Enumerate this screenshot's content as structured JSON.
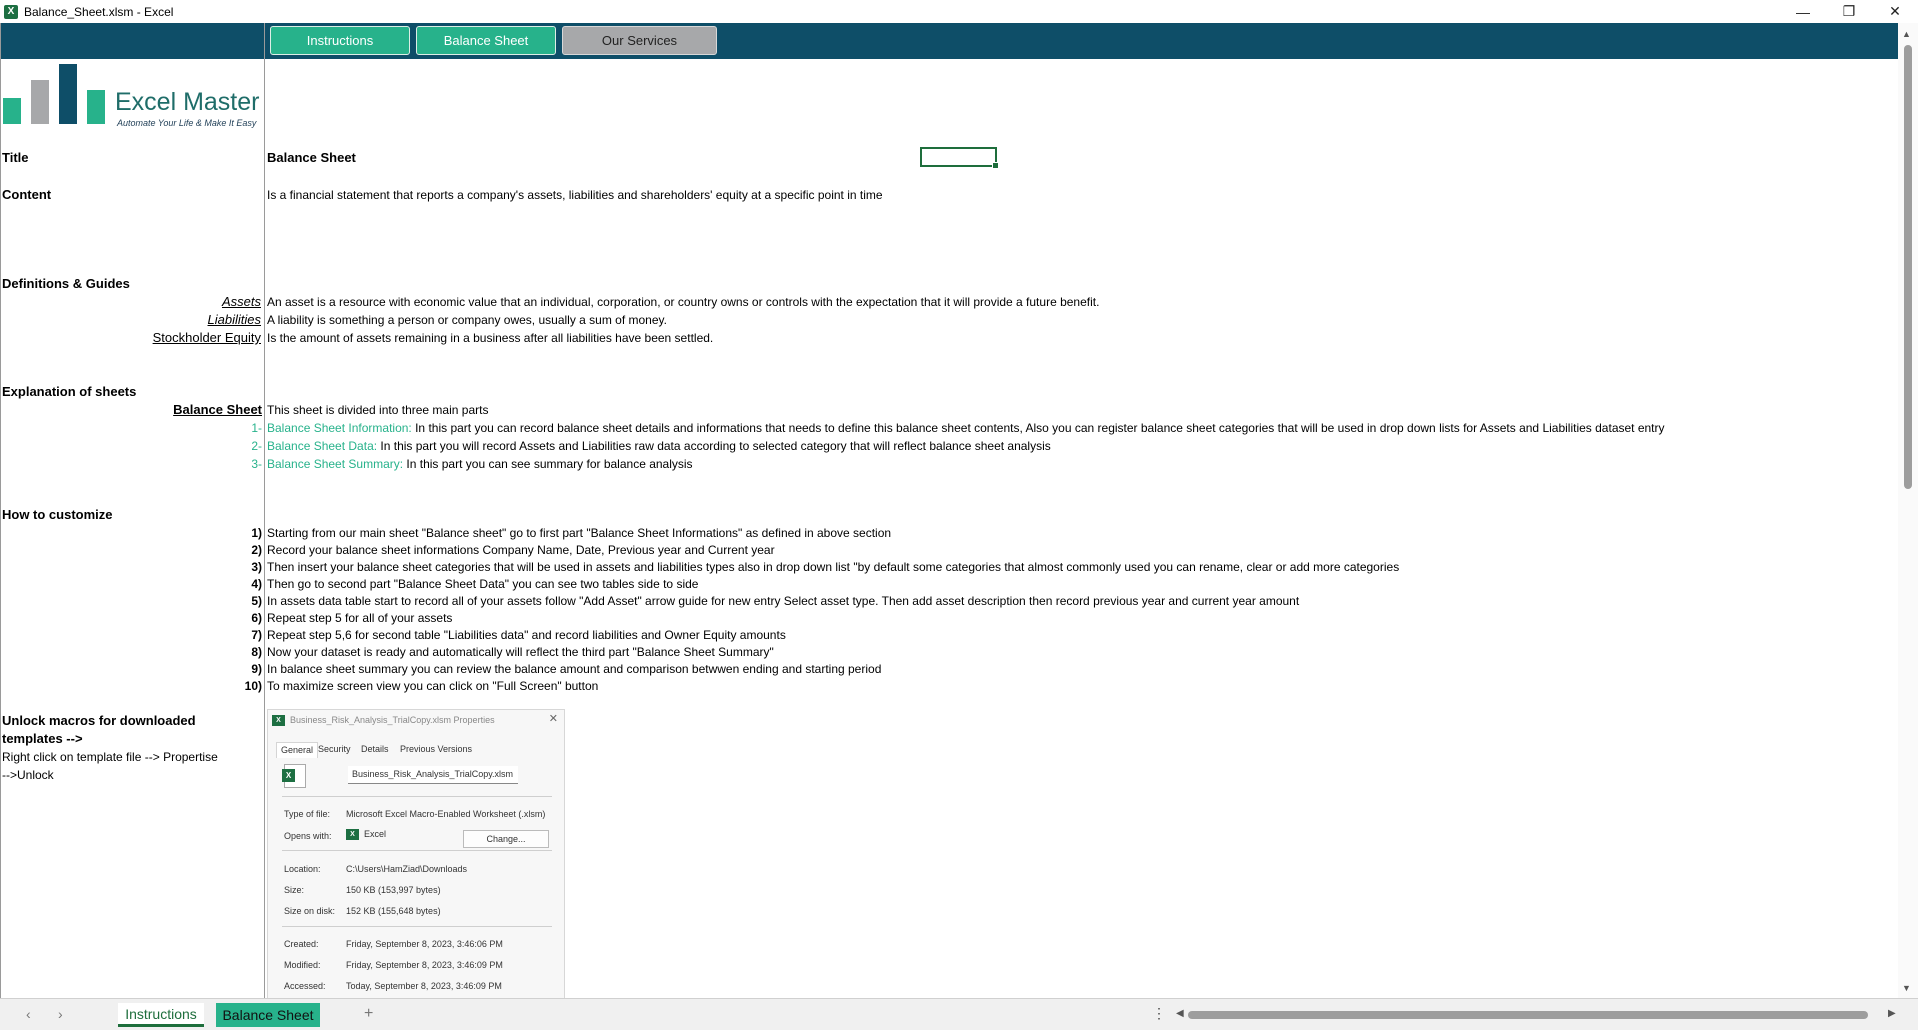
{
  "window": {
    "app_icon": "X",
    "title": "Balance_Sheet.xlsm - Excel",
    "minimize_icon": "minimize-icon",
    "restore_icon": "restore-icon",
    "close_icon": "close-icon"
  },
  "nav": {
    "instructions": "Instructions",
    "balance_sheet": "Balance Sheet",
    "our_services": "Our Services"
  },
  "logo": {
    "name": "Excel Master",
    "tagline": "Automate Your Life & Make It Easy"
  },
  "title": {
    "label": "Title",
    "value": "Balance Sheet"
  },
  "content": {
    "label": "Content",
    "value": "Is a financial statement that reports a company's assets, liabilities and shareholders' equity at a specific point in time"
  },
  "definitions": {
    "heading": "Definitions & Guides",
    "items": [
      {
        "term": "Assets",
        "text": "An asset is a resource with economic value that an individual, corporation, or country owns or controls with the expectation that it will provide a future benefit."
      },
      {
        "term": "Liabilities",
        "text": "A liability is something a person or company owes, usually a sum of money."
      },
      {
        "term": "Stockholder Equity",
        "text": "Is the amount of assets remaining in a business after all liabilities have been settled."
      }
    ]
  },
  "explanation": {
    "heading": "Explanation of sheets",
    "sheet_name": "Balance Sheet",
    "sheet_desc": "This sheet is divided into three main parts",
    "parts": [
      {
        "num": "1-",
        "name": "Balance Sheet Information:",
        "text": " In this part you can record balance sheet details and informations that needs to define this balance sheet contents, Also you can register balance sheet categories that will be used in drop down lists for Assets and Liabilities dataset entry"
      },
      {
        "num": "2-",
        "name": "Balance Sheet Data:",
        "text": " In this part you will record Assets and Liabilities raw data according to selected category that will reflect balance sheet analysis"
      },
      {
        "num": "3-",
        "name": "Balance Sheet Summary:",
        "text": " In this part you can see summary for balance analysis"
      }
    ]
  },
  "customize": {
    "heading": "How to customize",
    "steps": [
      {
        "num": "1)",
        "text": "Starting from our main sheet \"Balance sheet\" go to first part \"Balance Sheet Informations\" as defined in above section"
      },
      {
        "num": "2)",
        "text": "Record your balance sheet informations Company Name, Date, Previous year and Current year"
      },
      {
        "num": "3)",
        "text": "Then insert your balance sheet categories that will be used in assets and liabilities types also in drop down list \"by default some categories that almost commonly used you can rename, clear or add more categories"
      },
      {
        "num": "4)",
        "text": "Then go to second part \"Balance Sheet Data\" you can see two tables side to side"
      },
      {
        "num": "5)",
        "text": "In assets data table start to record all of your assets  follow \"Add Asset\" arrow guide for new entry Select asset type. Then add asset description then record previous year and current year amount"
      },
      {
        "num": "6)",
        "text": "Repeat step 5 for all of your assets"
      },
      {
        "num": "7)",
        "text": "Repeat step 5,6 for second table \"Liabilities data\" and record liabilities and Owner Equity amounts"
      },
      {
        "num": "8)",
        "text": "Now your dataset is ready and automatically will reflect the third part \"Balance Sheet Summary\""
      },
      {
        "num": "9)",
        "text": "In balance sheet summary you can review the balance amount and comparison betwwen ending and starting period"
      },
      {
        "num": "10)",
        "text": "To maximize screen view you can click on \"Full Screen\" button"
      }
    ]
  },
  "unlock": {
    "line1": "Unlock macros for downloaded",
    "line2": "templates -->",
    "line3": "Right click on template file --> Propertise",
    "line4": "-->Unlock"
  },
  "dialog": {
    "title": "Business_Risk_Analysis_TrialCopy.xlsm Properties",
    "tabs": [
      "General",
      "Security",
      "Details",
      "Previous Versions"
    ],
    "filename": "Business_Risk_Analysis_TrialCopy.xlsm",
    "type_label": "Type of file:",
    "type_value": "Microsoft Excel Macro-Enabled Worksheet (.xlsm)",
    "opens_label": "Opens with:",
    "opens_value": "Excel",
    "change_btn": "Change...",
    "location_label": "Location:",
    "location_value": "C:\\Users\\HamZiad\\Downloads",
    "size_label": "Size:",
    "size_value": "150 KB (153,997 bytes)",
    "size_disk_label": "Size on disk:",
    "size_disk_value": "152 KB (155,648 bytes)",
    "created_label": "Created:",
    "created_value": "Friday, September 8, 2023, 3:46:06 PM",
    "modified_label": "Modified:",
    "modified_value": "Friday, September 8, 2023, 3:46:09 PM",
    "accessed_label": "Accessed:",
    "accessed_value": "Today, September 8, 2023, 3:46:09 PM"
  },
  "tabs": {
    "instructions": "Instructions",
    "balance_sheet": "Balance Sheet",
    "add": "+"
  },
  "colors": {
    "nav_band": "#0e4e68",
    "accent_green": "#27b28b",
    "excel_green": "#1e6e3c"
  }
}
